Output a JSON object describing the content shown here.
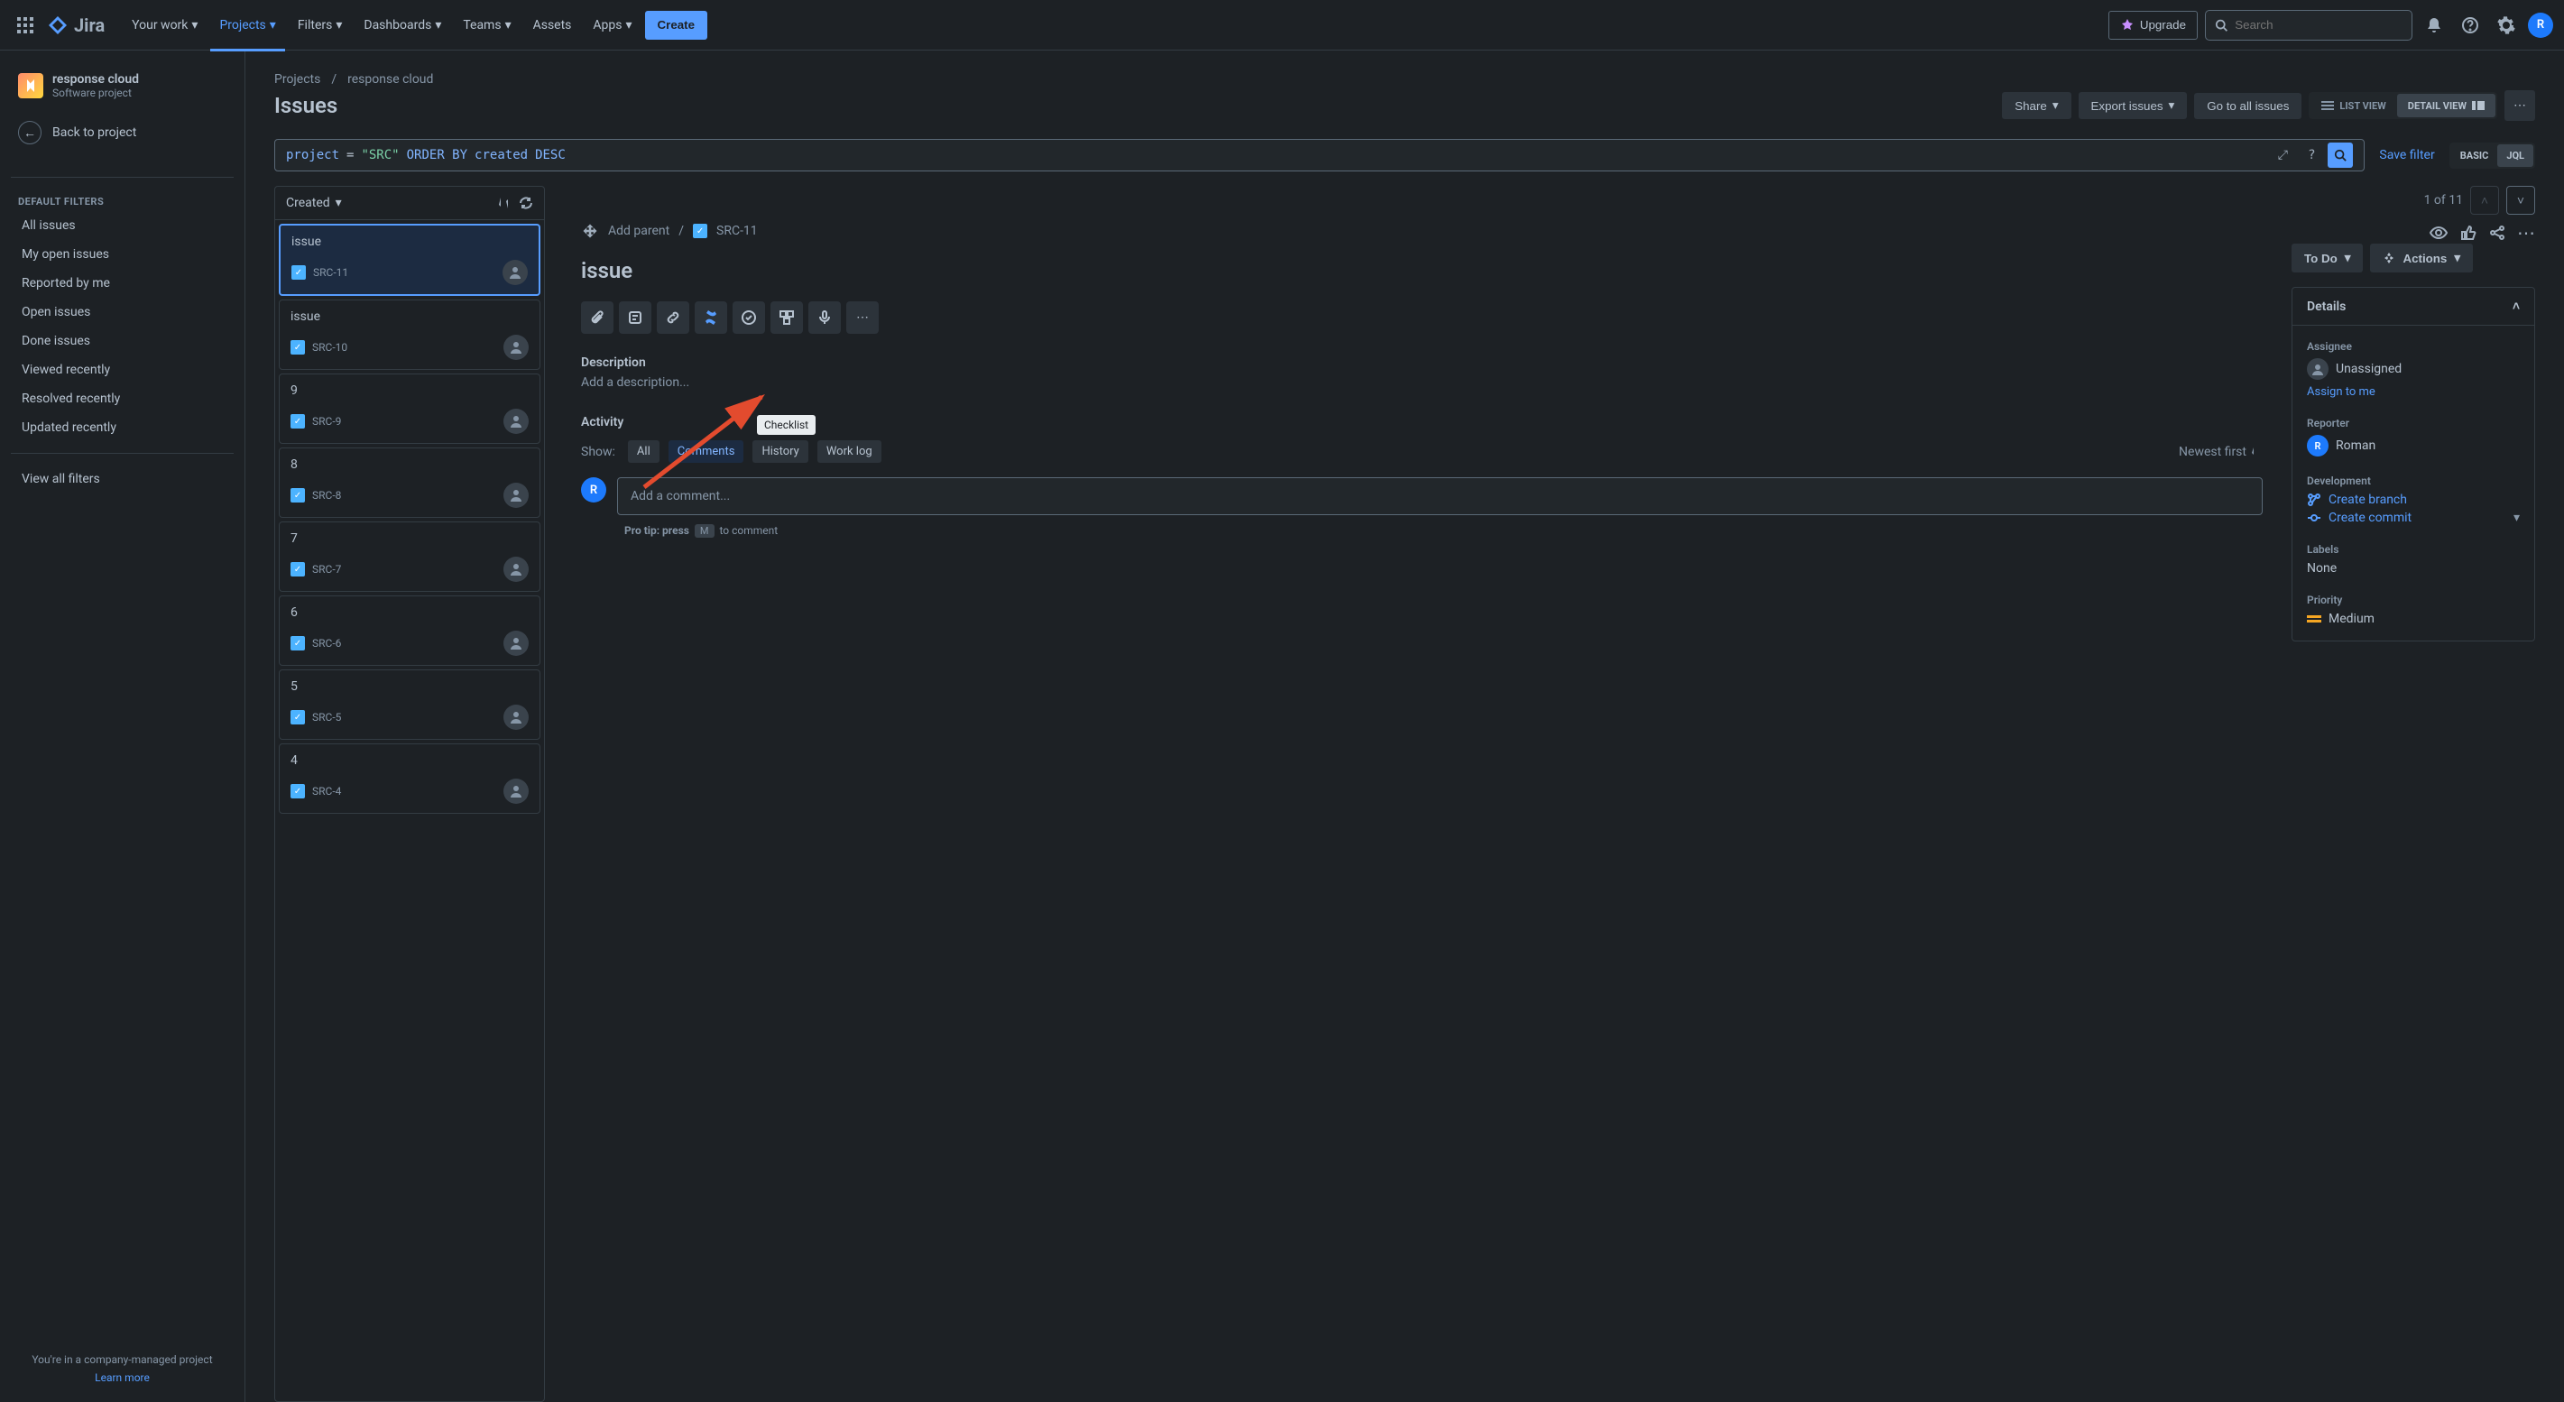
{
  "nav": {
    "logo": "Jira",
    "items": [
      "Your work",
      "Projects",
      "Filters",
      "Dashboards",
      "Teams",
      "Assets",
      "Apps"
    ],
    "active_index": 1,
    "create": "Create",
    "upgrade": "Upgrade",
    "search_placeholder": "Search",
    "avatar_initial": "R"
  },
  "sidebar": {
    "project_name": "response cloud",
    "project_sub": "Software project",
    "back": "Back to project",
    "section": "DEFAULT FILTERS",
    "filters": [
      "All issues",
      "My open issues",
      "Reported by me",
      "Open issues",
      "Done issues",
      "Viewed recently",
      "Resolved recently",
      "Updated recently"
    ],
    "view_all": "View all filters",
    "footer": "You're in a company-managed project",
    "learn_more": "Learn more"
  },
  "breadcrumb": [
    "Projects",
    "response cloud"
  ],
  "page_title": "Issues",
  "header_actions": {
    "share": "Share",
    "export": "Export issues",
    "go_all": "Go to all issues",
    "list_view": "LIST VIEW",
    "detail_view": "DETAIL VIEW"
  },
  "jql": {
    "field": "project",
    "op": "=",
    "str": "\"SRC\"",
    "key1": "ORDER BY",
    "field2": "created",
    "key2": "DESC",
    "save": "Save filter",
    "basic": "BASIC",
    "jql": "JQL"
  },
  "list": {
    "sort": "Created",
    "issues": [
      {
        "summary": "issue",
        "key": "SRC-11"
      },
      {
        "summary": "issue",
        "key": "SRC-10"
      },
      {
        "summary": "9",
        "key": "SRC-9"
      },
      {
        "summary": "8",
        "key": "SRC-8"
      },
      {
        "summary": "7",
        "key": "SRC-7"
      },
      {
        "summary": "6",
        "key": "SRC-6"
      },
      {
        "summary": "5",
        "key": "SRC-5"
      },
      {
        "summary": "4",
        "key": "SRC-4"
      }
    ],
    "selected_index": 0
  },
  "pager": "1 of 11",
  "detail": {
    "add_parent": "Add parent",
    "key": "SRC-11",
    "title": "issue",
    "description_label": "Description",
    "description_placeholder": "Add a description...",
    "activity_label": "Activity",
    "show_label": "Show:",
    "tabs": [
      "All",
      "Comments",
      "History",
      "Work log"
    ],
    "active_tab": 1,
    "newest": "Newest first",
    "comment_placeholder": "Add a comment...",
    "pro_tip_pre": "Pro tip: press",
    "pro_tip_key": "M",
    "pro_tip_post": "to comment",
    "tooltip": "Checklist",
    "status": "To Do",
    "actions": "Actions",
    "details_label": "Details",
    "assignee_label": "Assignee",
    "assignee_value": "Unassigned",
    "assign_me": "Assign to me",
    "reporter_label": "Reporter",
    "reporter_value": "Roman",
    "reporter_initial": "R",
    "dev_label": "Development",
    "create_branch": "Create branch",
    "create_commit": "Create commit",
    "labels_label": "Labels",
    "labels_value": "None",
    "priority_label": "Priority",
    "priority_value": "Medium"
  }
}
